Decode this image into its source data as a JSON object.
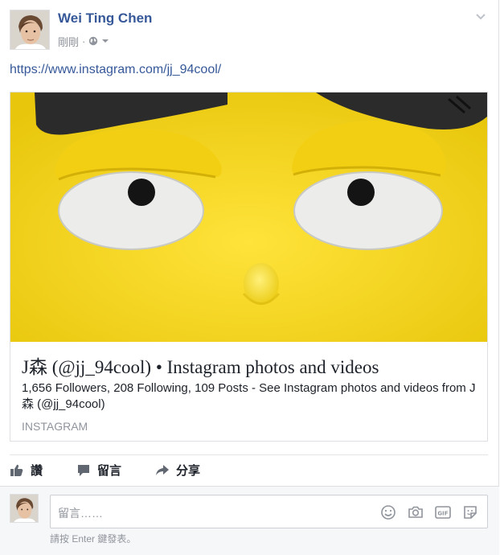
{
  "post": {
    "author": "Wei Ting Chen",
    "timestamp": "剛剛",
    "separator": "·",
    "privacy_icon": "globe-icon",
    "link_url_text": "https://www.instagram.com/jj_94cool/"
  },
  "card": {
    "image_subject": "yellow cartoon face with sleepy eyes",
    "title": "J森 (@jj_94cool) • Instagram photos and videos",
    "description": "1,656 Followers, 208 Following, 109 Posts - See Instagram photos and videos from J森 (@jj_94cool)",
    "domain": "INSTAGRAM"
  },
  "actions": {
    "like": "讚",
    "comment": "留言",
    "share": "分享"
  },
  "comment": {
    "placeholder": "留言……",
    "hint": "請按 Enter 鍵發表。",
    "icons": [
      "emoji-icon",
      "camera-icon",
      "gif-icon",
      "sticker-icon"
    ]
  },
  "colors": {
    "link_blue": "#365899",
    "secondary_text": "#90949c",
    "card_yellow": "#f4d21f",
    "border": "#dddfe2"
  }
}
